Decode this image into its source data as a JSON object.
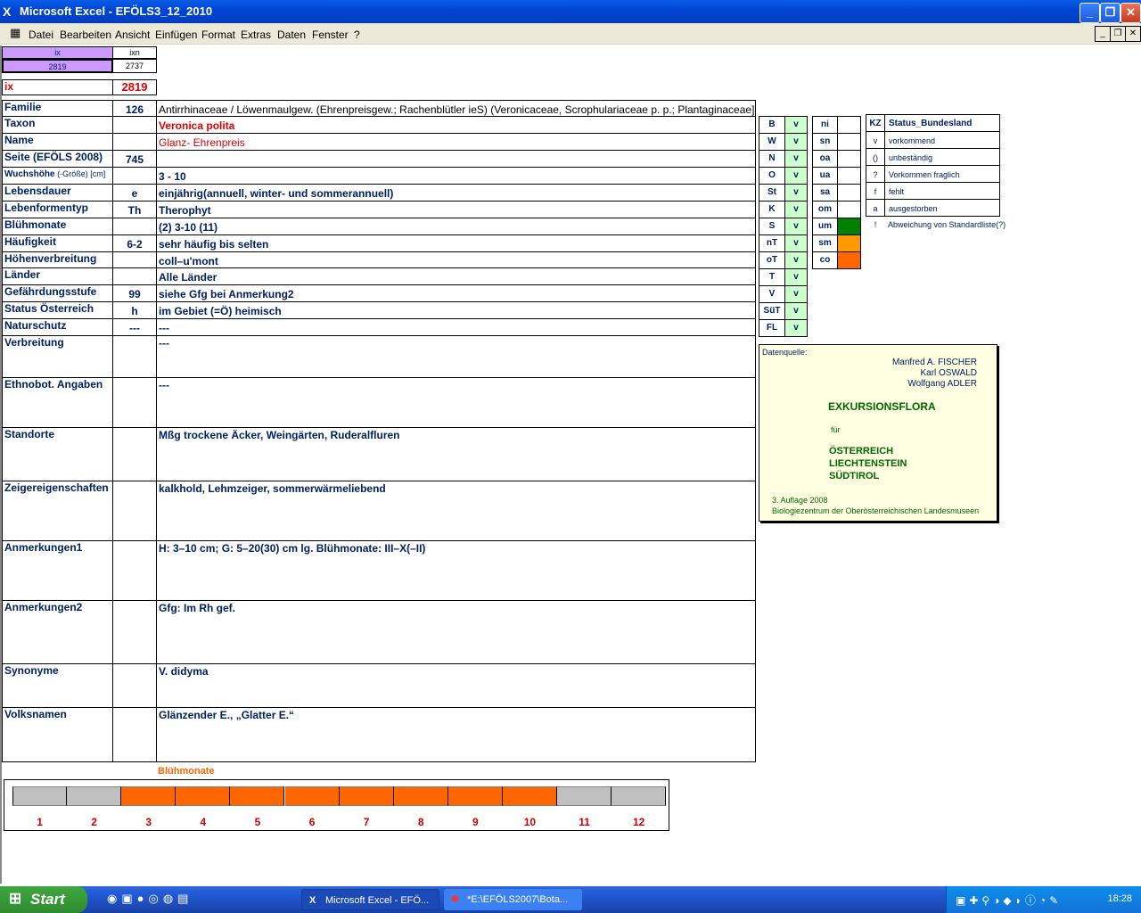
{
  "window": {
    "title": "Microsoft Excel - EFÖLS3_12_2010"
  },
  "menu": [
    "Datei",
    "Bearbeiten",
    "Ansicht",
    "Einfügen",
    "Format",
    "Extras",
    "Daten",
    "Fenster",
    "?"
  ],
  "header_cells": {
    "ix_label": "ix",
    "ixn_label": "ixn",
    "ix_val": "2819",
    "ixn_val": "2737",
    "ix_big_label": "ix",
    "ix_big_val": "2819"
  },
  "rows": [
    {
      "label": "Familie",
      "code": "126",
      "text": "Antirrhinaceae  /  Löwenmaulgew. (Ehrenpreisgew.; Rachenblütler ieS) (Veronicaceae, Scrophulariaceae p. p.; Plantaginaceae]"
    },
    {
      "label": "Taxon",
      "code": "",
      "text": "Veronica polita"
    },
    {
      "label": "Name",
      "code": "",
      "text": "Glanz- Ehrenpreis"
    },
    {
      "label": "Seite (EFÖLS 2008)",
      "code": "745",
      "text": ""
    },
    {
      "label": "Wuchshöhe",
      "label_small": "(-Größe) [cm]",
      "code": "",
      "text": "3 - 10"
    },
    {
      "label": "Lebensdauer",
      "code": "e",
      "text": "einjährig(annuell, winter- und sommerannuell)"
    },
    {
      "label": "Lebenformentyp",
      "code": "Th",
      "text": "Therophyt"
    },
    {
      "label": "Blühmonate",
      "code": "",
      "text": "(2) 3-10 (11)"
    },
    {
      "label": "Häufigkeit",
      "code": "6-2",
      "text": "sehr häufig bis selten"
    },
    {
      "label": "Höhenverbreitung",
      "code": "",
      "text": "coll–u'mont"
    },
    {
      "label": "Länder",
      "code": "",
      "text": "Alle Länder"
    },
    {
      "label": "Gefährdungsstufe",
      "code": "99",
      "text": "siehe Gfg bei Anmerkung2"
    },
    {
      "label": "Status Österreich",
      "code": "h",
      "text": "im Gebiet (=Ö) heimisch"
    },
    {
      "label": "Naturschutz",
      "code": "---",
      "text": "---"
    },
    {
      "label": "Verbreitung",
      "code": "",
      "text": "---"
    },
    {
      "label": "Ethnobot. Angaben",
      "code": "",
      "text": "---"
    },
    {
      "label": "Standorte",
      "code": "",
      "text": "Mßg trockene Äcker, Weingärten, Ruderalfluren"
    },
    {
      "label": "Zeigereigenschaften",
      "code": "",
      "text": "kalkhold, Lehmzeiger, sommerwärmeliebend"
    },
    {
      "label": "Anmerkungen1",
      "code": "",
      "text": "H: 3–10 cm; G: 5–20(30) cm lg.  Blühmonate: III–X(–II)"
    },
    {
      "label": "Anmerkungen2",
      "code": "",
      "text": "Gfg:  Im Rh gef."
    },
    {
      "label": "Synonyme",
      "code": "",
      "text": "V. didyma"
    },
    {
      "label": "Volksnamen",
      "code": "",
      "text": "Glänzender E., „Glatter E.“"
    }
  ],
  "laender": [
    {
      "k": "B",
      "v": "v"
    },
    {
      "k": "W",
      "v": "v"
    },
    {
      "k": "N",
      "v": "v"
    },
    {
      "k": "O",
      "v": "v"
    },
    {
      "k": "St",
      "v": "v"
    },
    {
      "k": "K",
      "v": "v"
    },
    {
      "k": "S",
      "v": "v"
    },
    {
      "k": "nT",
      "v": "v"
    },
    {
      "k": "oT",
      "v": "v"
    },
    {
      "k": "T",
      "v": "v"
    },
    {
      "k": "V",
      "v": "v"
    },
    {
      "k": "SüT",
      "v": "v"
    },
    {
      "k": "FL",
      "v": "v"
    }
  ],
  "hoehen": [
    "ni",
    "sn",
    "oa",
    "ua",
    "sa",
    "om",
    "um",
    "sm",
    "co"
  ],
  "status_legend": {
    "header_kz": "KZ",
    "header_name": "Status_Bundesland",
    "items": [
      {
        "k": "v",
        "t": "vorkommend"
      },
      {
        "k": "()",
        "t": "unbeständig"
      },
      {
        "k": "?",
        "t": "Vorkommen fraglich"
      },
      {
        "k": "f",
        "t": "fehlt"
      },
      {
        "k": "a",
        "t": "ausgestorben"
      },
      {
        "k": "!",
        "t": "Abweichung von Standardliste(?)"
      }
    ]
  },
  "source_box": {
    "label": "Datenquelle:",
    "authors": [
      "Manfred A. FISCHER",
      "Karl OSWALD",
      "Wolfgang ADLER"
    ],
    "title": "EXKURSIONSFLORA",
    "fuer": "für",
    "countries": [
      "ÖSTERREICH",
      "LIECHTENSTEIN",
      "SÜDTIROL"
    ],
    "edition": "3. Auflage 2008",
    "publisher": "Biologiezentrum der Oberösterreichischen Landesmuseen"
  },
  "bloom": {
    "title": "Blühmonate",
    "months": [
      "1",
      "2",
      "3",
      "4",
      "5",
      "6",
      "7",
      "8",
      "9",
      "10",
      "11",
      "12"
    ],
    "active": [
      false,
      false,
      true,
      true,
      true,
      true,
      true,
      true,
      true,
      true,
      false,
      false
    ],
    "colors": {
      "active": "#ff6600",
      "inactive": "#c0c0c0"
    }
  },
  "taskbar": {
    "start": "Start",
    "tasks": [
      "Microsoft Excel - EFÖ...",
      "*E:\\EFÖLS2007\\Bota..."
    ],
    "clock": "18:28"
  },
  "colors": {
    "status_um": "#008000",
    "status_sm": "#ff9900",
    "status_co": "#ff6600",
    "header_purple": "#cc99ff"
  }
}
